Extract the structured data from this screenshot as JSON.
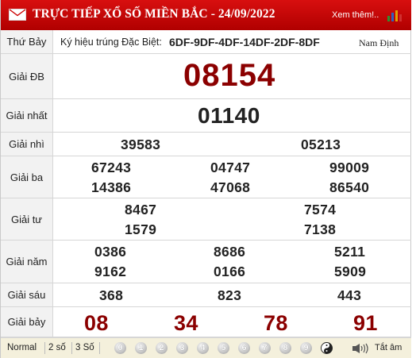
{
  "header": {
    "title": "TRỰC TIẾP XỔ SỐ MIỀN BẮC - 24/09/2022",
    "more_link": "Xem thêm!..",
    "mail_icon": "mail-icon",
    "bars_icon": "bar-chart-icon",
    "background": "#c80c0c"
  },
  "info_row": {
    "weekday": "Thứ Bảy",
    "special_code_label": "Ký hiệu trúng Đặc Biệt:",
    "special_codes": "6DF-9DF-4DF-14DF-2DF-8DF",
    "province": "Nam Định"
  },
  "prizes": {
    "db": {
      "label": "Giải ĐB",
      "numbers": [
        "08154"
      ]
    },
    "g1": {
      "label": "Giải nhất",
      "numbers": [
        "01140"
      ]
    },
    "g2": {
      "label": "Giải nhì",
      "numbers": [
        "39583",
        "05213"
      ]
    },
    "g3": {
      "label": "Giải ba",
      "numbers": [
        "67243",
        "04747",
        "99009",
        "14386",
        "47068",
        "86540"
      ]
    },
    "g4": {
      "label": "Giải tư",
      "numbers": [
        "8467",
        "7574",
        "1579",
        "7138"
      ]
    },
    "g5": {
      "label": "Giải năm",
      "numbers": [
        "0386",
        "8686",
        "5211",
        "9162",
        "0166",
        "5909"
      ]
    },
    "g6": {
      "label": "Giải sáu",
      "numbers": [
        "368",
        "823",
        "443"
      ]
    },
    "g7": {
      "label": "Giải bảy",
      "numbers": [
        "08",
        "34",
        "78",
        "91"
      ]
    }
  },
  "footer": {
    "normal": "Normal",
    "two_digits": "2 số",
    "three_digits": "3 Số",
    "digits": [
      "0",
      "1",
      "2",
      "3",
      "4",
      "5",
      "6",
      "7",
      "8",
      "9"
    ],
    "mute_label": "Tắt âm",
    "yinyang_icon": "yin-yang-icon",
    "speaker_icon": "speaker-icon",
    "background": "#f4f0dc"
  },
  "colors": {
    "accent_red": "#8b0000",
    "label_bg": "#f2f2f2"
  }
}
